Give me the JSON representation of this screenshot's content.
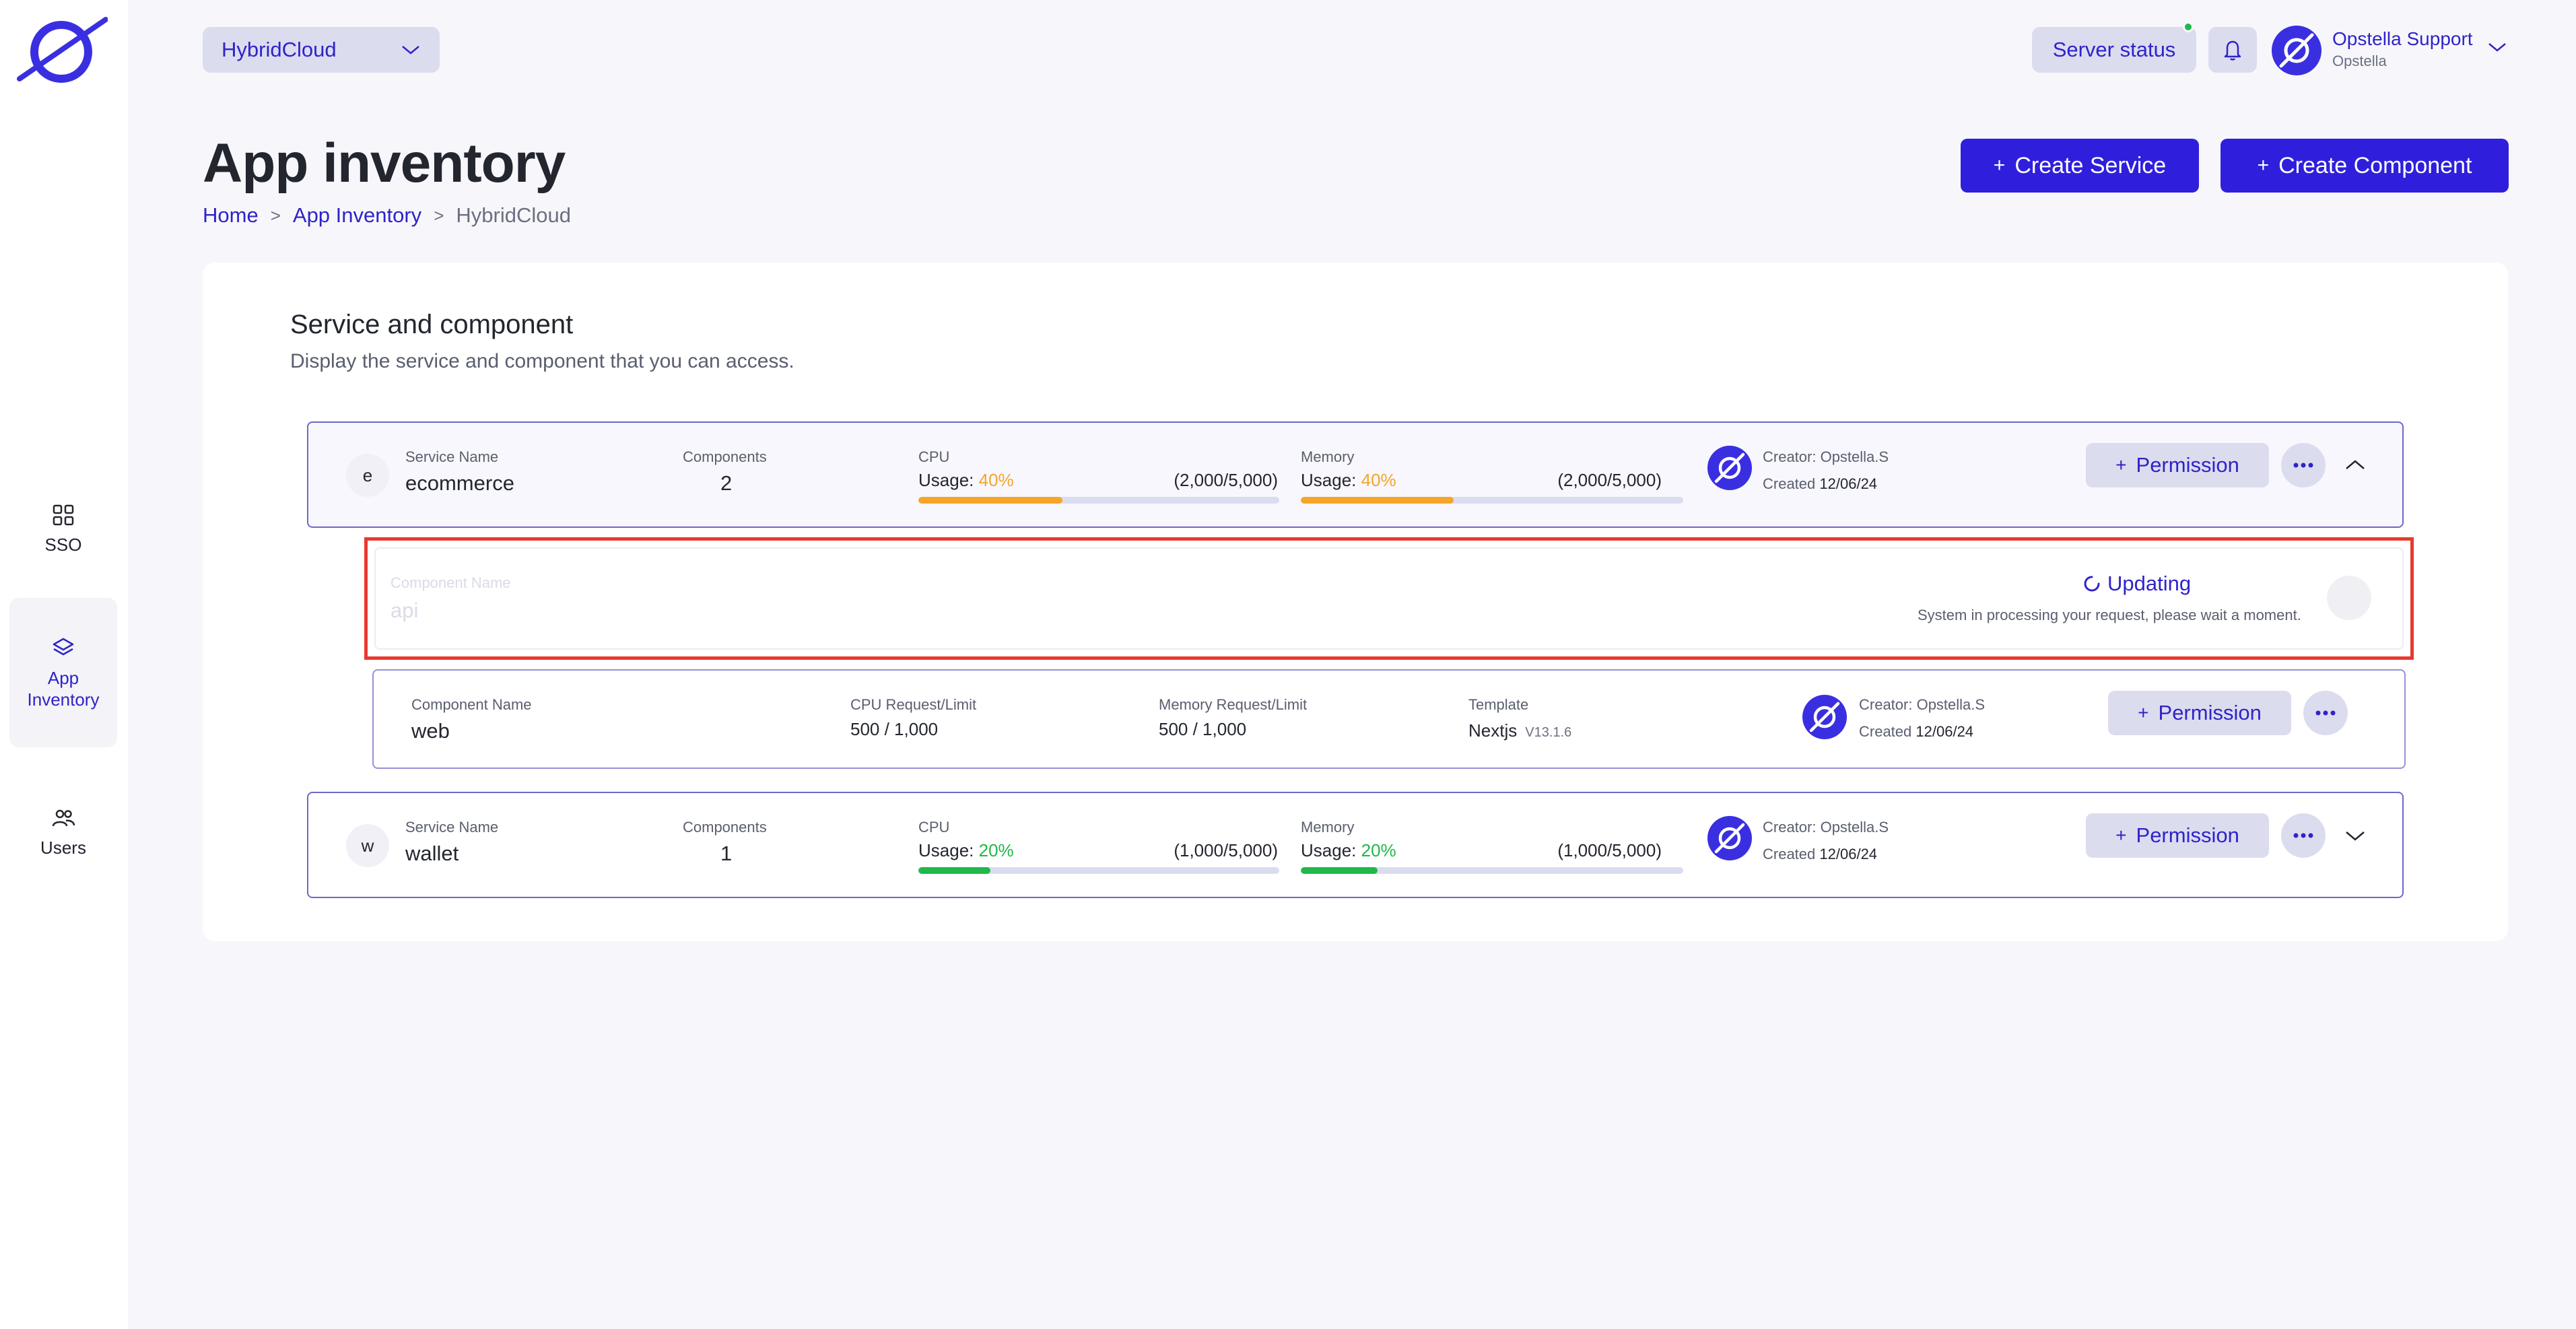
{
  "sidebar": {
    "items": [
      {
        "label": "SSO",
        "icon": "grid-icon"
      },
      {
        "label": "App Inventory",
        "icon": "layers-icon"
      },
      {
        "label": "Users",
        "icon": "users-icon"
      }
    ]
  },
  "header": {
    "project": "HybridCloud",
    "server_status": "Server status",
    "user_name": "Opstella Support",
    "user_org": "Opstella"
  },
  "page": {
    "title": "App inventory",
    "breadcrumb": [
      "Home",
      "App Inventory",
      "HybridCloud"
    ],
    "create_service": "Create Service",
    "create_component": "Create Component"
  },
  "card": {
    "title": "Service and component",
    "subtitle": "Display the service and component that you can access."
  },
  "labels": {
    "service_name": "Service Name",
    "components": "Components",
    "cpu": "CPU",
    "memory": "Memory",
    "usage": "Usage:",
    "component_name": "Component Name",
    "cpu_request": "CPU Request/Limit",
    "memory_request": "Memory Request/Limit",
    "template": "Template",
    "created": "Created",
    "permission": "Permission"
  },
  "services": [
    {
      "letter": "e",
      "name": "ecommerce",
      "components": "2",
      "cpu_pct": "40%",
      "cpu_fraction": 0.4,
      "cpu_ratio": "(2,000/5,000)",
      "mem_pct": "40%",
      "mem_fraction": 0.4,
      "mem_ratio": "(2,000/5,000)",
      "creator": "Creator: Opstella.S",
      "created_date": "12/06/24",
      "color": "#f4a52a"
    },
    {
      "letter": "w",
      "name": "wallet",
      "components": "1",
      "cpu_pct": "20%",
      "cpu_fraction": 0.2,
      "cpu_ratio": "(1,000/5,000)",
      "mem_pct": "20%",
      "mem_fraction": 0.2,
      "mem_ratio": "(1,000/5,000)",
      "creator": "Creator: Opstella.S",
      "created_date": "12/06/24",
      "color": "#20b84a"
    }
  ],
  "updating_component": {
    "name": "api",
    "status": "Updating",
    "message": "System in processing your request, please wait a moment."
  },
  "web_component": {
    "name": "web",
    "cpu": "500 / 1,000",
    "memory": "500 / 1,000",
    "template": "Nextjs",
    "version": "V13.1.6",
    "creator": "Creator: Opstella.S",
    "created_date": "12/06/24"
  },
  "colors": {
    "accent": "#2f1fdc",
    "highlight_border": "#e8392e"
  }
}
